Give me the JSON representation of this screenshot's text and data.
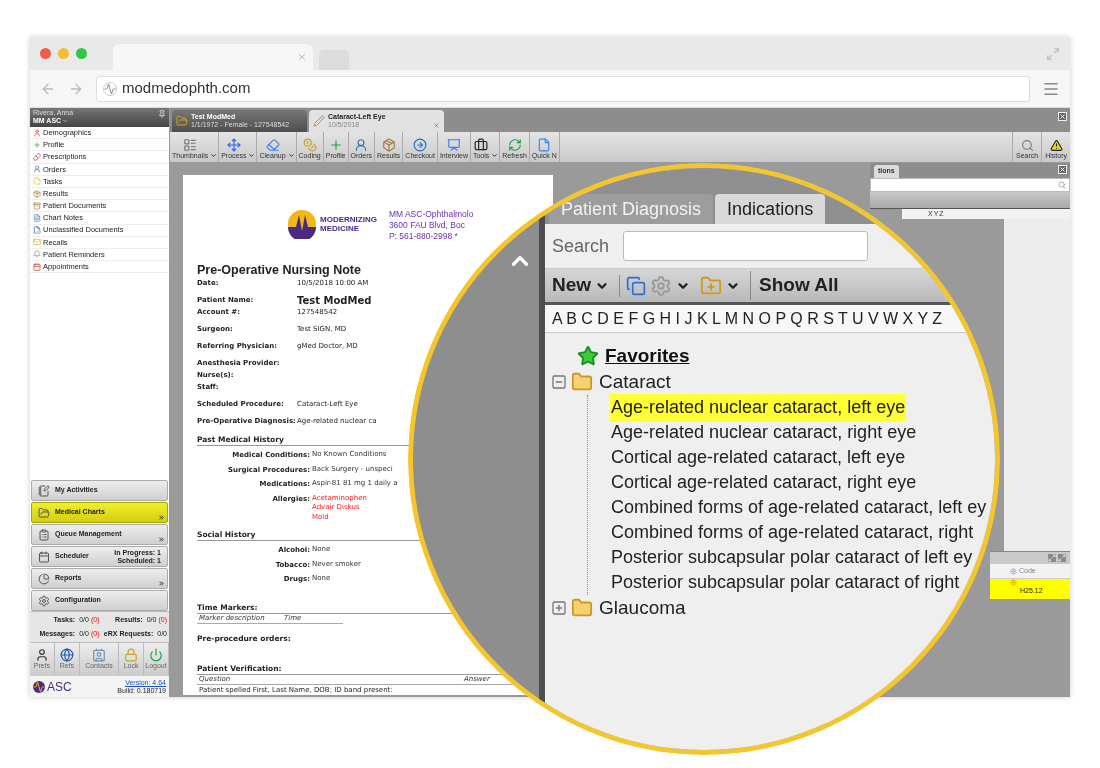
{
  "browser": {
    "url": "modmedophth.com"
  },
  "sidebar": {
    "user": "Rivera, Anna",
    "location": "MM ASC",
    "items": [
      "Demographics",
      "Profile",
      "Prescriptions",
      "Orders",
      "Tasks",
      "Results",
      "Patient Documents",
      "Chart Notes",
      "Unclassified Documents",
      "Recalls",
      "Patient Reminders",
      "Appointments"
    ],
    "nav": [
      {
        "label": "My Activities",
        "selected": false,
        "more": false
      },
      {
        "label": "Medical Charts",
        "selected": true,
        "more": true
      },
      {
        "label": "Queue Management",
        "selected": false,
        "more": true
      },
      {
        "label": "Scheduler",
        "selected": false,
        "more": false,
        "info": [
          "In Progress: 1",
          "Scheduled: 1"
        ]
      },
      {
        "label": "Reports",
        "selected": false,
        "more": true
      },
      {
        "label": "Configuration",
        "selected": false,
        "more": false
      }
    ],
    "stats": [
      {
        "label": "Tasks:",
        "value": "0/0",
        "flag": "(0)"
      },
      {
        "label": "Results:",
        "value": "0/0",
        "flag": "(0)"
      },
      {
        "label": "Messages:",
        "value": "0/0",
        "flag": "(0)"
      },
      {
        "label": "eRX Requests:",
        "value": "0/0"
      }
    ],
    "tools": [
      "Prefs",
      "Refs",
      "Contacts",
      "Lock",
      "Logout"
    ],
    "brand": "ASC",
    "version": "Version: 4.64",
    "build": "Build: 0.180719"
  },
  "tabs": [
    {
      "title": "Test ModMed",
      "subtitle": "1/1/1972 - Female - 127548542",
      "selected": false
    },
    {
      "title": "Cataract-Left Eye",
      "subtitle": "10/5/2018",
      "selected": true
    }
  ],
  "toolbar": [
    {
      "label": "Thumbnails",
      "dropdown": true
    },
    {
      "label": "Process",
      "dropdown": true
    },
    {
      "label": "Cleanup",
      "dropdown": true
    },
    {
      "label": "Coding",
      "dropdown": false
    },
    {
      "label": "Profile",
      "dropdown": false
    },
    {
      "label": "Orders",
      "dropdown": false
    },
    {
      "label": "Results",
      "dropdown": false
    },
    {
      "label": "Checkout",
      "dropdown": false
    },
    {
      "label": "Interview",
      "dropdown": false
    },
    {
      "label": "Tools",
      "dropdown": true
    },
    {
      "label": "Refresh",
      "dropdown": false
    },
    {
      "label": "Quick N",
      "dropdown": false
    }
  ],
  "toolbar_right": [
    "Search",
    "History"
  ],
  "document": {
    "logo": [
      "MODERNIZING",
      "MEDICINE"
    ],
    "address": [
      "MM ASC-Ophthalmolo",
      "3600 FAU Blvd, Boc",
      "P: 561-880-2998 *"
    ],
    "title": "Pre-Operative Nursing Note",
    "fields": [
      {
        "label": "Date:",
        "value": "10/5/2018 10:00 AM",
        "emphasis": false
      },
      {
        "label": "Patient Name:",
        "value": "Test ModMed",
        "emphasis": true
      },
      {
        "label": "Account #:",
        "value": "127548542",
        "emphasis": false
      },
      {
        "label": "Surgeon:",
        "value": "Test SIGN, MD",
        "emphasis": false
      },
      {
        "label": "Referring Physician:",
        "value": "gMed Doctor, MD",
        "emphasis": false
      },
      {
        "label": "Anesthesia Provider:"
      },
      {
        "label": "Nurse(s):"
      },
      {
        "label": "Staff:"
      },
      {
        "label": "Scheduled Procedure:",
        "value": "Cataract-Left Eye",
        "emphasis": false
      },
      {
        "label": "Pre-Operative Diagnosis:",
        "value": "Age-related nuclear ca",
        "emphasis": false
      }
    ],
    "sections": [
      {
        "title": "Past Medical History",
        "kind": "rows",
        "rows": [
          {
            "label": "Medical Conditions:",
            "values": [
              {
                "text": "No Known Conditions",
                "alert": false
              }
            ]
          },
          {
            "label": "Surgical Procedures:",
            "values": [
              {
                "text": "Back Surgery - unspeci",
                "alert": false
              }
            ]
          },
          {
            "label": "Medications:",
            "values": [
              {
                "text": "Aspir-81 81 mg 1 daily a",
                "alert": false
              }
            ]
          },
          {
            "label": "Allergies:",
            "values": [
              {
                "text": "Acetaminophen",
                "alert": true
              },
              {
                "text": "Advair Diskus",
                "alert": true
              },
              {
                "text": "Mold",
                "alert": true
              }
            ]
          }
        ]
      },
      {
        "title": "Social History",
        "kind": "rows",
        "rows": [
          {
            "label": "Alcohol:",
            "values": [
              {
                "text": "None",
                "alert": false
              }
            ]
          },
          {
            "label": "Tobacco:",
            "values": [
              {
                "text": "Never smoker",
                "alert": false
              }
            ]
          },
          {
            "label": "Drugs:",
            "values": [
              {
                "text": "None",
                "alert": false
              }
            ]
          }
        ]
      },
      {
        "title": "Time Markers:",
        "kind": "table",
        "columns": [
          "Marker description",
          "Time"
        ]
      },
      {
        "title": "Pre-procedure orders:",
        "kind": "heading"
      },
      {
        "title": "Patient Verification:",
        "kind": "table",
        "columns": [
          "Question",
          "Answer"
        ],
        "rows": [
          "Patient spelled First, Last Name, DOB; ID band present:"
        ]
      }
    ]
  },
  "side_panel": {
    "tab": "tions",
    "alphabet": "XYZ",
    "column": "Code",
    "row": {
      "code": "H25.12",
      "selected": true
    }
  },
  "magnifier": {
    "tabs": [
      {
        "label": "Patient Diagnosis",
        "selected": false
      },
      {
        "label": "Indications",
        "selected": true
      }
    ],
    "search_label": "Search",
    "new_button": "New",
    "show_all": "Show All",
    "alphabet": "A B C D E F G H I J K L M N O P Q R S T U V W X Y Z",
    "tree": [
      {
        "label": "Favorites",
        "kind": "favorites"
      },
      {
        "label": "Cataract",
        "kind": "folder",
        "expanded": true,
        "children": [
          {
            "label": "Age-related nuclear cataract, left eye",
            "selected": true
          },
          {
            "label": "Age-related nuclear cataract, right eye",
            "selected": false
          },
          {
            "label": "Cortical age-related cataract, left eye",
            "selected": false
          },
          {
            "label": "Cortical age-related cataract, right eye",
            "selected": false
          },
          {
            "label": "Combined forms of age-related cataract, left ey",
            "selected": false
          },
          {
            "label": "Combined forms of age-related cataract, right",
            "selected": false
          },
          {
            "label": "Posterior subcapsular polar cataract of left ey",
            "selected": false
          },
          {
            "label": "Posterior subcapsular polar cataract of right",
            "selected": false
          }
        ]
      },
      {
        "label": "Glaucoma",
        "kind": "folder",
        "expanded": false
      }
    ]
  }
}
